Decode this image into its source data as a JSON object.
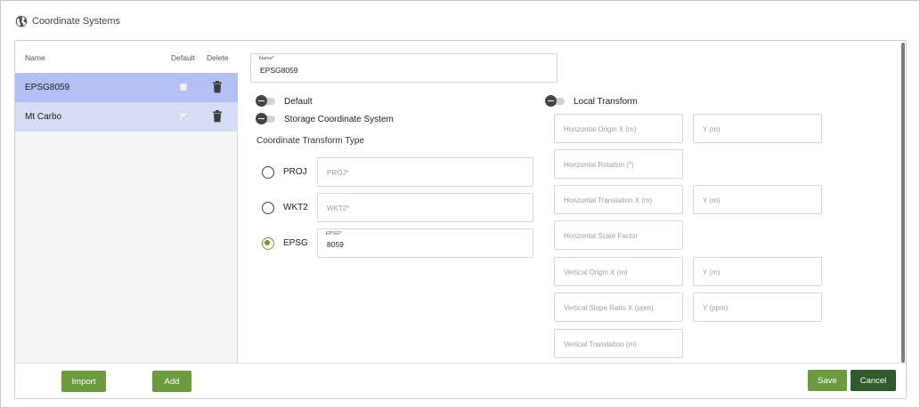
{
  "window": {
    "title": "Coordinate Systems",
    "icon": "globe-icon"
  },
  "list": {
    "headers": {
      "name": "Name",
      "default": "Default",
      "delete": "Delete"
    },
    "rows": [
      {
        "name": "EPSG8059",
        "default": false,
        "selected": true
      },
      {
        "name": "Mt Carbo",
        "default": true,
        "selected": false
      }
    ],
    "import_label": "Import",
    "add_label": "Add"
  },
  "form": {
    "name": {
      "label": "Name*",
      "value": "EPSG8059"
    },
    "default_toggle": {
      "label": "Default",
      "on": false
    },
    "storage_toggle": {
      "label": "Storage Coordinate System",
      "on": false
    },
    "local_transform_toggle": {
      "label": "Local Transform",
      "on": false
    },
    "transform_type_label": "Coordinate Transform Type",
    "transform_options": [
      {
        "label": "PROJ",
        "checked": false,
        "field_label": "",
        "placeholder": "PROJ*",
        "value": ""
      },
      {
        "label": "WKT2",
        "checked": false,
        "field_label": "",
        "placeholder": "WKT2*",
        "value": ""
      },
      {
        "label": "EPSG",
        "checked": true,
        "field_label": "EPSG*",
        "placeholder": "",
        "value": "8059"
      }
    ],
    "local_fields": {
      "horizontal_origin_x": "Horizontal Origin X (m)",
      "horizontal_origin_y": "Y (m)",
      "horizontal_rotation": "Horizontal Rotation (°)",
      "horizontal_translation_x": "Horizontal Translation X (m)",
      "horizontal_translation_y": "Y (m)",
      "horizontal_scale": "Horizontal Scale Factor",
      "vertical_origin_x": "Vertical Origin X (m)",
      "vertical_origin_y": "Y (m)",
      "vertical_slope_x": "Vertical Slope Ratio X (ppm)",
      "vertical_slope_y": "Y (ppm)",
      "vertical_translation": "Vertical Translation (m)"
    },
    "save_label": "Save",
    "cancel_label": "Cancel"
  },
  "colors": {
    "accent_green": "#6c9a3e",
    "dark_green": "#2f5a2b",
    "row_selected": "#b4bff4",
    "row_alt": "#d6dbf6"
  }
}
